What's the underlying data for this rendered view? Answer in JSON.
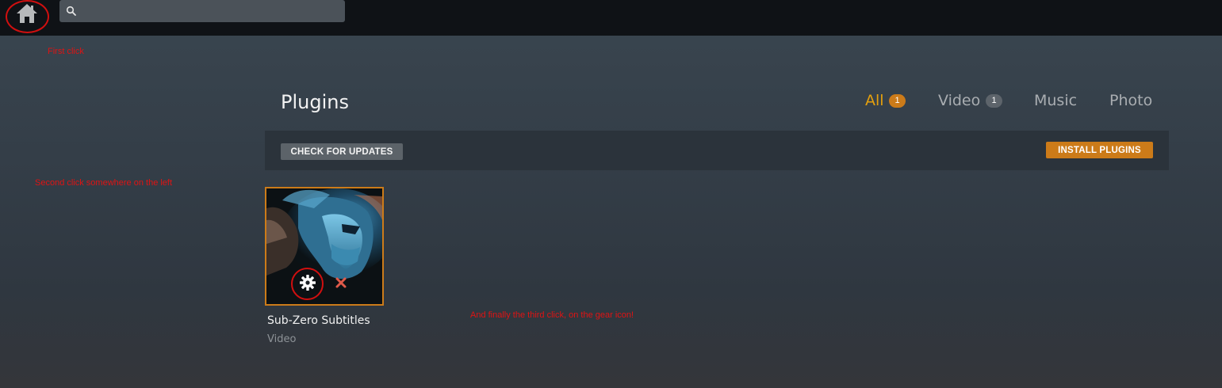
{
  "topbar": {
    "home_icon": "home-icon",
    "search": {
      "value": "",
      "placeholder": "",
      "icon": "search-icon"
    }
  },
  "annotations": {
    "first": "First click",
    "second": "Second click somewhere on the left",
    "third": "And finally the third click, on the gear icon!"
  },
  "page": {
    "title": "Plugins"
  },
  "tabs": [
    {
      "label": "All",
      "count": "1",
      "active": true
    },
    {
      "label": "Video",
      "count": "1",
      "active": false
    },
    {
      "label": "Music",
      "active": false
    },
    {
      "label": "Photo",
      "active": false
    }
  ],
  "toolbar": {
    "check_updates_label": "CHECK FOR UPDATES",
    "install_plugins_label": "INSTALL PLUGINS"
  },
  "plugins": [
    {
      "name": "Sub-Zero Subtitles",
      "type": "Video",
      "settings_icon": "gear-icon",
      "remove_icon": "close-icon"
    }
  ],
  "colors": {
    "accent": "#e5a00d",
    "accent_button": "#cc7b19",
    "annotation_red": "#e01313",
    "topbar_bg": "#0f1216"
  }
}
